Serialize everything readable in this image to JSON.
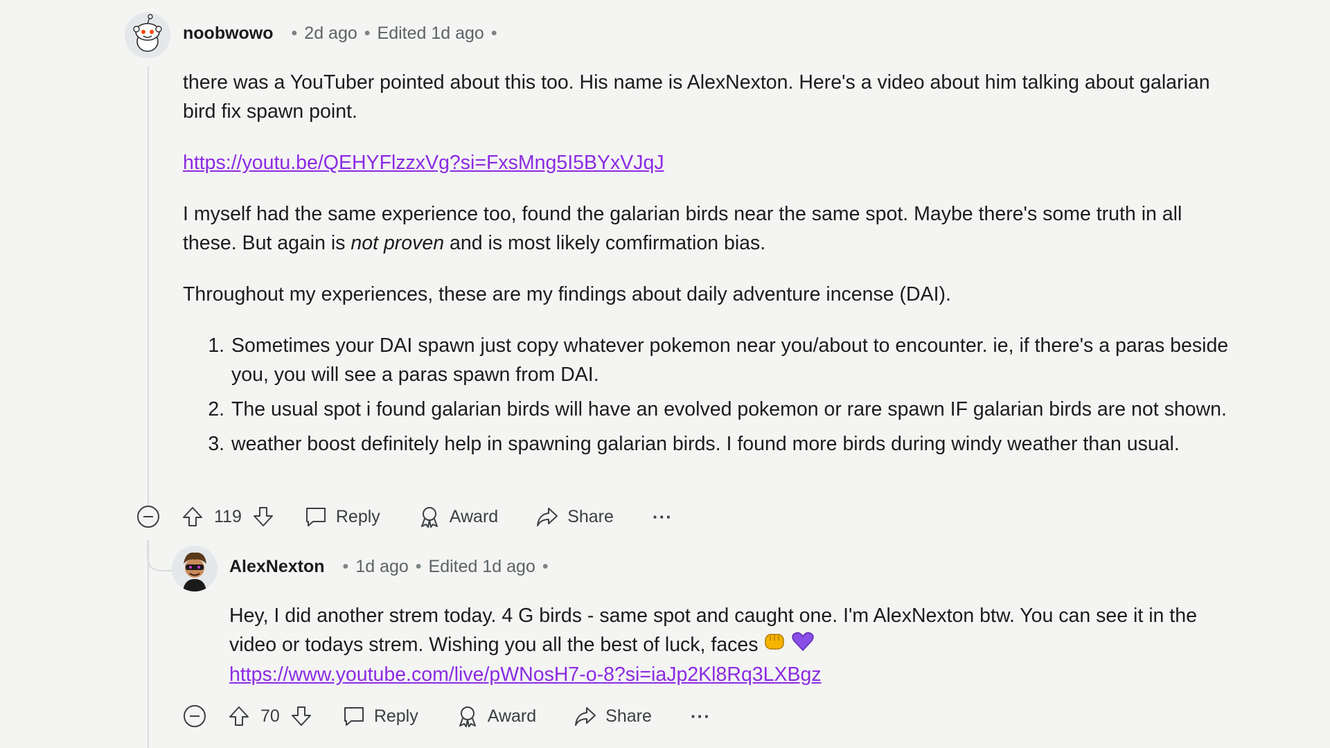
{
  "comments": [
    {
      "author": "noobwowo",
      "age": "2d ago",
      "edited": "Edited 1d ago",
      "p1": "there was a YouTuber pointed about this too. His name is AlexNexton. Here's a video about him talking about galarian bird fix spawn point.",
      "link": "https://youtu.be/QEHYFlzzxVg?si=FxsMng5I5BYxVJqJ",
      "p2_before": "I myself had the same experience too, found the galarian birds near the same spot. Maybe there's some truth in all these. But again is ",
      "p2_italic": "not proven",
      "p2_after": " and is most likely comfirmation bias.",
      "p3": "Throughout my experiences, these are my findings about daily adventure incense (DAI).",
      "list": [
        "Sometimes your DAI spawn just copy whatever pokemon near you/about to encounter. ie, if there's a paras beside you, you will see a paras spawn from DAI.",
        "The usual spot i found galarian birds will have an evolved pokemon or rare spawn IF galarian birds are not shown.",
        "weather boost definitely help in spawning galarian birds. I found more birds during windy weather than usual."
      ],
      "votes": "119",
      "reply_label": "Reply",
      "award_label": "Award",
      "share_label": "Share",
      "more_label": "···"
    },
    {
      "author": "AlexNexton",
      "age": "1d ago",
      "edited": "Edited 1d ago",
      "p1": "Hey, I did another strem today. 4 G birds - same spot and caught one. I'm AlexNexton btw. You can see it in the video or todays strem. Wishing you all the best of luck, faces",
      "link": "https://www.youtube.com/live/pWNosH7-o-8?si=iaJp2Kl8Rq3LXBgz",
      "votes": "70",
      "reply_label": "Reply",
      "award_label": "Award",
      "share_label": "Share",
      "more_label": "···"
    }
  ],
  "separator": "•",
  "colors": {
    "link": "#8b2be2",
    "background": "#f4f4f3",
    "thread_line": "#d9dcdd"
  },
  "icons": [
    "collapse-icon",
    "upvote-icon",
    "downvote-icon",
    "comment-icon",
    "award-icon",
    "share-icon",
    "fist-emoji",
    "purple-heart-emoji"
  ]
}
